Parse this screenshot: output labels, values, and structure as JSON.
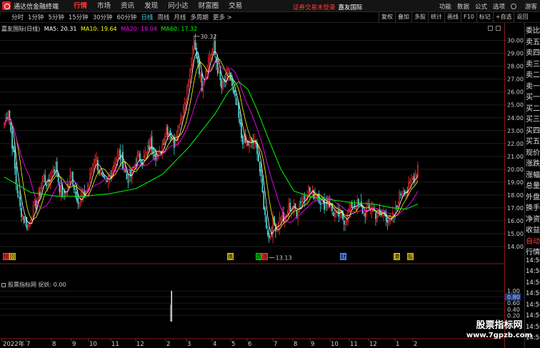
{
  "app": {
    "title": "通达信金融终端",
    "menu": [
      "行情",
      "市场",
      "资讯",
      "发现",
      "问小达",
      "财富圈",
      "交易"
    ],
    "active_menu": "行情",
    "notice": "证券交易未登录",
    "notice_broker": "嘉友国际",
    "right_menu": [
      "功能",
      "数据",
      "公式",
      "选项"
    ],
    "guest": "游客"
  },
  "periods": [
    "分时",
    "1分钟",
    "5分钟",
    "15分钟",
    "30分钟",
    "60分钟",
    "日线",
    "周线",
    "月线",
    "多周期",
    "更多 >"
  ],
  "active_period": "日线",
  "tools": [
    "复权",
    "叠加",
    "多股",
    "统计",
    "画线",
    "F10",
    "标记",
    "+自选",
    "返回"
  ],
  "legend": {
    "stock": "嘉友国际(日线)",
    "ma5": "MA5: 20.31",
    "ma10": "MA10: 19.64",
    "ma20": "MA20: 19.04",
    "ma60": "MA60: 17.32"
  },
  "indicator_legend": "股票指标网  捉妖: 0.00",
  "colors": {
    "up": "#ff3030",
    "down": "#4dd9d9",
    "ma5": "#ffffff",
    "ma10": "#ffff00",
    "ma20": "#ff00ff",
    "ma60": "#00ff00"
  },
  "chart_data": {
    "type": "candlestick",
    "y_ticks": [
      "30.00",
      "29.00",
      "28.00",
      "27.00",
      "26.00",
      "25.00",
      "24.00",
      "23.00",
      "22.00",
      "21.00",
      "20.00",
      "19.00",
      "18.00",
      "17.00",
      "16.00",
      "15.00",
      "14.00"
    ],
    "ylim": [
      13.5,
      30.7
    ],
    "high_label": "30.32",
    "low_label": "13.13",
    "indicator_ticks": [
      "1.00",
      "0.80",
      "0.60",
      "0.40",
      "0.20"
    ],
    "indicator_value_box": "0.80",
    "x_labels": [
      "2022年",
      "7",
      "8",
      "9",
      "10",
      "11",
      "12",
      "2",
      "3",
      "4",
      "5",
      "6",
      "7",
      "8",
      "9",
      "10",
      "11",
      "12",
      "1",
      "2"
    ],
    "markers": [
      {
        "label": "除",
        "color": "#ff3030"
      },
      {
        "label": "回",
        "color": "#e0c000"
      },
      {
        "label": "携",
        "color": "#e0c000"
      },
      {
        "label": "跌",
        "color": "#00d000"
      },
      {
        "label": "涨",
        "color": "#ff3030"
      },
      {
        "label": "财",
        "color": "#4d8cff"
      },
      {
        "label": "港",
        "color": "#e0c000"
      },
      {
        "label": "股",
        "color": "#e0c000"
      }
    ],
    "indicator_spike": {
      "value": 1.0
    },
    "close_path": [
      [
        0,
        23.5
      ],
      [
        3,
        24.8
      ],
      [
        6,
        22.0
      ],
      [
        9,
        19.0
      ],
      [
        12,
        17.0
      ],
      [
        15,
        16.1
      ],
      [
        18,
        15.6
      ],
      [
        21,
        16.5
      ],
      [
        24,
        17.3
      ],
      [
        27,
        18.2
      ],
      [
        30,
        19.4
      ],
      [
        33,
        18.8
      ],
      [
        36,
        19.8
      ],
      [
        39,
        20.3
      ],
      [
        42,
        18.6
      ],
      [
        45,
        17.9
      ],
      [
        48,
        18.7
      ],
      [
        51,
        19.6
      ],
      [
        54,
        18.2
      ],
      [
        57,
        17.5
      ],
      [
        60,
        18.0
      ],
      [
        63,
        18.4
      ],
      [
        66,
        19.8
      ],
      [
        69,
        21.0
      ],
      [
        72,
        19.9
      ],
      [
        75,
        19.0
      ],
      [
        78,
        18.8
      ],
      [
        81,
        19.8
      ],
      [
        84,
        20.7
      ],
      [
        87,
        21.2
      ],
      [
        90,
        20.5
      ],
      [
        93,
        19.3
      ],
      [
        96,
        19.5
      ],
      [
        99,
        20.4
      ],
      [
        102,
        21.0
      ],
      [
        105,
        20.6
      ],
      [
        108,
        21.2
      ],
      [
        111,
        22.1
      ],
      [
        114,
        21.4
      ],
      [
        117,
        20.8
      ],
      [
        120,
        21.9
      ],
      [
        123,
        23.2
      ],
      [
        126,
        22.8
      ],
      [
        129,
        22.0
      ],
      [
        132,
        23.3
      ],
      [
        135,
        24.4
      ],
      [
        138,
        25.6
      ],
      [
        141,
        27.6
      ],
      [
        144,
        29.6
      ],
      [
        147,
        28.4
      ],
      [
        150,
        26.5
      ],
      [
        153,
        27.8
      ],
      [
        156,
        28.9
      ],
      [
        159,
        29.4
      ],
      [
        162,
        27.8
      ],
      [
        165,
        26.3
      ],
      [
        168,
        26.9
      ],
      [
        171,
        27.5
      ],
      [
        174,
        25.7
      ],
      [
        177,
        24.6
      ],
      [
        180,
        22.5
      ],
      [
        183,
        22.0
      ],
      [
        186,
        21.9
      ],
      [
        189,
        22.2
      ],
      [
        192,
        21.6
      ],
      [
        195,
        19.0
      ],
      [
        198,
        16.3
      ],
      [
        201,
        14.6
      ],
      [
        204,
        15.8
      ],
      [
        207,
        15.5
      ],
      [
        210,
        16.4
      ],
      [
        213,
        16.0
      ],
      [
        216,
        17.0
      ],
      [
        219,
        17.2
      ],
      [
        222,
        16.7
      ],
      [
        225,
        17.6
      ],
      [
        228,
        17.8
      ],
      [
        231,
        18.5
      ],
      [
        234,
        18.0
      ],
      [
        237,
        18.2
      ],
      [
        240,
        17.6
      ],
      [
        243,
        17.3
      ],
      [
        246,
        17.6
      ],
      [
        249,
        16.8
      ],
      [
        252,
        16.3
      ],
      [
        255,
        16.5
      ],
      [
        258,
        16.1
      ],
      [
        261,
        16.6
      ],
      [
        264,
        17.2
      ],
      [
        267,
        17.3
      ],
      [
        270,
        17.1
      ],
      [
        273,
        16.6
      ],
      [
        276,
        16.8
      ],
      [
        279,
        17.1
      ],
      [
        282,
        16.5
      ],
      [
        285,
        16.4
      ],
      [
        288,
        16.6
      ],
      [
        291,
        16.2
      ],
      [
        294,
        16.0
      ],
      [
        297,
        16.7
      ],
      [
        300,
        17.9
      ],
      [
        303,
        18.6
      ],
      [
        306,
        18.3
      ],
      [
        309,
        19.0
      ],
      [
        312,
        19.6
      ],
      [
        314,
        20.3
      ]
    ],
    "ma60_path": [
      [
        0,
        19.4
      ],
      [
        20,
        18.2
      ],
      [
        40,
        17.9
      ],
      [
        60,
        17.9
      ],
      [
        80,
        18.1
      ],
      [
        100,
        18.5
      ],
      [
        120,
        19.6
      ],
      [
        140,
        21.7
      ],
      [
        160,
        24.3
      ],
      [
        170,
        26.0
      ],
      [
        178,
        26.8
      ],
      [
        185,
        26.2
      ],
      [
        192,
        24.6
      ],
      [
        200,
        22.5
      ],
      [
        210,
        20.0
      ],
      [
        220,
        18.3
      ],
      [
        235,
        17.8
      ],
      [
        250,
        17.6
      ],
      [
        265,
        17.4
      ],
      [
        280,
        17.3
      ],
      [
        295,
        17.0
      ],
      [
        305,
        16.9
      ],
      [
        314,
        17.3
      ]
    ]
  },
  "quote_panel": [
    {
      "text": "委比",
      "cls": ""
    },
    {
      "text": "卖五",
      "cls": ""
    },
    {
      "text": "卖四",
      "cls": ""
    },
    {
      "text": "卖三",
      "cls": ""
    },
    {
      "text": "卖二",
      "cls": ""
    },
    {
      "text": "卖一",
      "cls": ""
    },
    {
      "text": "买一",
      "cls": ""
    },
    {
      "text": "买二",
      "cls": ""
    },
    {
      "text": "买三",
      "cls": ""
    },
    {
      "text": "买四",
      "cls": ""
    },
    {
      "text": "买五",
      "cls": ""
    },
    {
      "text": "现价",
      "cls": ""
    },
    {
      "text": "涨跌",
      "cls": ""
    },
    {
      "text": "涨幅",
      "cls": ""
    },
    {
      "text": "总量",
      "cls": ""
    },
    {
      "text": "外盘",
      "cls": ""
    },
    {
      "text": "换手",
      "cls": ""
    },
    {
      "text": "净资",
      "cls": ""
    },
    {
      "text": "收益",
      "cls": ""
    },
    {
      "text": "自动",
      "cls": "red"
    },
    {
      "text": "行情",
      "cls": ""
    },
    {
      "text": "14:50",
      "cls": "time"
    },
    {
      "text": "14:50",
      "cls": "time"
    },
    {
      "text": "14:50",
      "cls": "time"
    },
    {
      "text": "14:50",
      "cls": "time"
    },
    {
      "text": "14:50",
      "cls": "time"
    },
    {
      "text": "14:50",
      "cls": "time"
    },
    {
      "text": "14:50",
      "cls": "time"
    },
    {
      "text": "14:50",
      "cls": "time"
    }
  ],
  "watermark": {
    "line1": "股票指标网",
    "line2": "www.7gpzb.com"
  }
}
